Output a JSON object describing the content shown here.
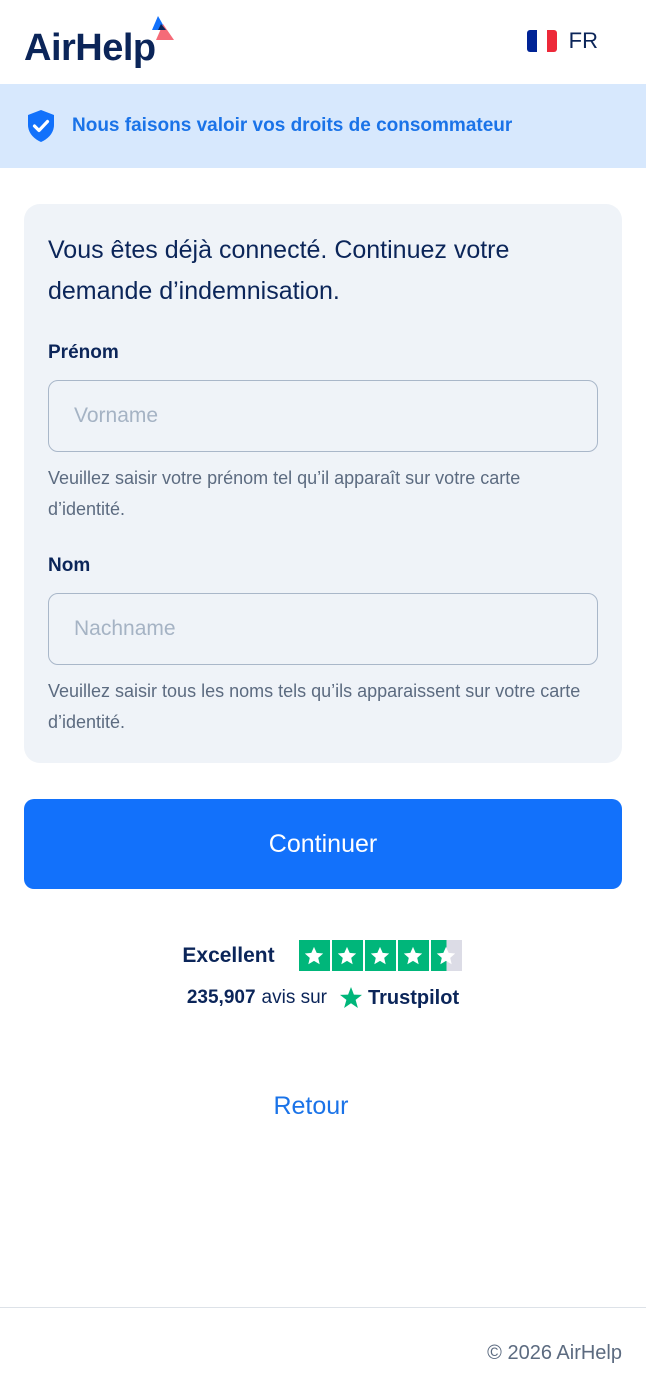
{
  "header": {
    "logo_text": "AirHelp",
    "language": {
      "code": "FR",
      "flag_colors": [
        "#002395",
        "#ffffff",
        "#ed2939"
      ]
    }
  },
  "banner": {
    "icon": "shield-check-icon",
    "text": "Nous faisons valoir vos droits de consommateur"
  },
  "form": {
    "title": "Vous êtes déjà connecté. Continuez votre demande d’indemnisation.",
    "first_name": {
      "label": "Prénom",
      "placeholder": "Vorname",
      "value": "",
      "hint": "Veuillez saisir votre prénom tel qu’il apparaît sur votre carte d’identité."
    },
    "last_name": {
      "label": "Nom",
      "placeholder": "Nachname",
      "value": "",
      "hint": "Veuillez saisir tous les noms tels qu’ils apparaissent sur votre carte d’identité."
    },
    "submit_label": "Continuer"
  },
  "trustpilot": {
    "rating_label": "Excellent",
    "stars": 4.5,
    "review_count": "235,907",
    "reviews_text": "avis sur",
    "brand": "Trustpilot",
    "star_color": "#00b67a"
  },
  "back_label": "Retour",
  "footer": {
    "copyright": "© 2026 AirHelp"
  },
  "colors": {
    "primary": "#1271fb",
    "navy": "#0b2559",
    "banner_bg": "#d7e8fd",
    "card_bg": "#eff3f8"
  }
}
